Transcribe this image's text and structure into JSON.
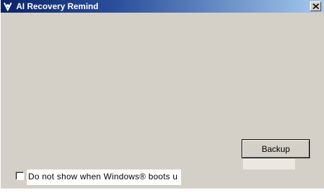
{
  "window": {
    "title": "AI Recovery Remind",
    "title_icon": "app-logo-icon",
    "close_icon": "close-icon"
  },
  "main": {
    "backup_label": "Backup",
    "dont_show_label": "Do not show when Windows® boots u",
    "dont_show_checked": false
  },
  "colors": {
    "titlebar_start": "#0a246a",
    "titlebar_end": "#a6caf0",
    "window_background": "#d4d0c8"
  }
}
